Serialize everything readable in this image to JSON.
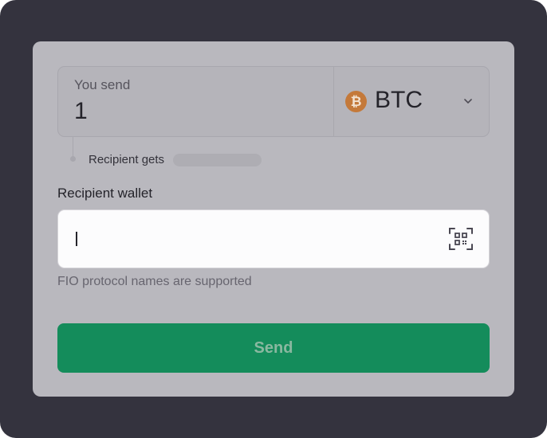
{
  "send": {
    "label": "You send",
    "amount": "1",
    "currency": {
      "code": "BTC",
      "icon": "bitcoin-icon",
      "icon_glyph": "₿",
      "color": "#c4793a"
    }
  },
  "recipient": {
    "gets_label": "Recipient gets"
  },
  "wallet": {
    "label": "Recipient wallet",
    "value": "",
    "hint": "FIO protocol names are supported",
    "scan_icon": "qr-scan-icon"
  },
  "actions": {
    "send_label": "Send",
    "send_color": "#148c5b"
  }
}
